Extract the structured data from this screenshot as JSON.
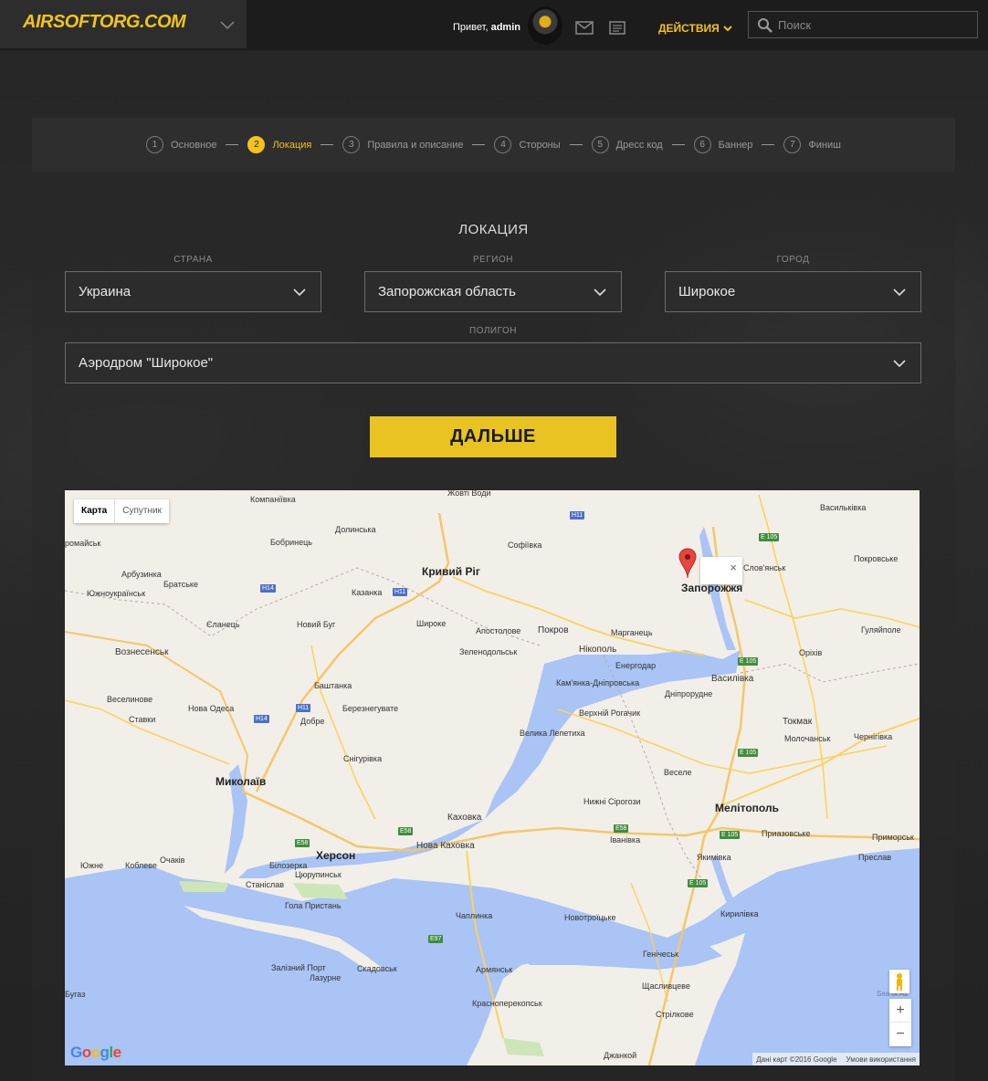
{
  "header": {
    "logo_text": "AIRSOFTORG.COM",
    "greeting_prefix": "Привет,",
    "username": "admin",
    "actions_label": "ДЕЙСТВИЯ",
    "search_placeholder": "Поиск",
    "accent_color": "#f2c31a",
    "icons": [
      "chevron-down-icon",
      "mail-icon",
      "news-icon",
      "search-icon"
    ]
  },
  "steps": [
    {
      "num": "1",
      "label": "Основное",
      "active": false
    },
    {
      "num": "2",
      "label": "Локация",
      "active": true
    },
    {
      "num": "3",
      "label": "Правила и описание",
      "active": false
    },
    {
      "num": "4",
      "label": "Стороны",
      "active": false
    },
    {
      "num": "5",
      "label": "Дресс код",
      "active": false
    },
    {
      "num": "6",
      "label": "Баннер",
      "active": false
    },
    {
      "num": "7",
      "label": "Финиш",
      "active": false
    }
  ],
  "form": {
    "title": "ЛОКАЦИЯ",
    "country": {
      "label": "СТРАНА",
      "value": "Украина"
    },
    "region": {
      "label": "РЕГИОН",
      "value": "Запорожская область"
    },
    "city": {
      "label": "ГОРОД",
      "value": "Широкое"
    },
    "polygon": {
      "label": "ПОЛИГОН",
      "value": "Аэродром \"Широкое\""
    },
    "next_button": "ДАЛЬШЕ"
  },
  "map": {
    "type_buttons": [
      "Карта",
      "Супутник"
    ],
    "infowindow_close": "×",
    "zoom_in": "+",
    "zoom_out": "−",
    "attribution": "Дані карт ©2016 Google",
    "terms": "Умови використання",
    "google": "Google",
    "sea_label": "Sea of Az",
    "cities": {
      "zhovti_vody": "Жовті Води",
      "kompaniivka": "Компаніївка",
      "dolynska": "Долинська",
      "bobrynets": "Бобринець",
      "sofiivka": "Софіївка",
      "kryvyi_rih": "Кривий Ріг",
      "kazanka": "Казанка",
      "shyroke": "Широке",
      "novyi_buh": "Новий Буг",
      "apostolove": "Апостолове",
      "pokrov": "Покров",
      "marhanets": "Марганець",
      "zelenodolsk": "Зеленодольськ",
      "nikopol": "Нікополь",
      "enerhodar": "Енергодар",
      "kamianka": "Кам'янка-Дніпровська",
      "dniprorudne": "Дніпрорудне",
      "vasylivka": "Василівка",
      "zaporizhzhia": "Запорожжя",
      "vasylkivka": "Васильківка",
      "slovianka": "Слов'янськ",
      "pokrovske": "Покровське",
      "huliaipole": "Гуляйполе",
      "orikhiv": "Оріхів",
      "tokmak": "Токмак",
      "molochansk": "Молочанськ",
      "chernihivka": "Чернігівка",
      "voznesensk": "Вознесенськ",
      "yuzhnoukrainsk": "Южноукраїнськ",
      "arbuzynka": "Арбузинка",
      "bratske": "Братське",
      "elanets": "Єланець",
      "bashtanka": "Баштанка",
      "veselynove": "Веселинове",
      "nova_odesa": "Нова Одеса",
      "bereznehuvate": "Березнегувате",
      "stavky": "Ставки",
      "dobre": "Добре",
      "snihurivka": "Снігурівка",
      "velyka_lepetykha": "Велика Лепетиха",
      "verkhnii_rohachyk": "Верхній Рогачик",
      "vesele": "Веселе",
      "mykolaiv": "Миколаїв",
      "melitopol": "Мелітополь",
      "nyzhni_sirohozy": "Нижні Сірогози",
      "kakhovka": "Каховка",
      "nova_kakhovka": "Нова Каховка",
      "ivanivka": "Іванівка",
      "pryazovske": "Приазовське",
      "prymorsk": "Приморськ",
      "yakymivka": "Якимівка",
      "preslav": "Преслав",
      "kherson": "Херсон",
      "tsiurupynsk": "Цюрупинськ",
      "biloziarka": "Білозерка",
      "ochakiv": "Очаків",
      "koblevo": "Коблеве",
      "yuzhne": "Южне",
      "stanislav": "Станіслав",
      "hola_prystan": "Гола Пристань",
      "chaplynka": "Чаплинка",
      "novotroitske": "Новотроїцьке",
      "kyrylivka": "Кирилівка",
      "henichesk": "Генічеськ",
      "skadovsk": "Скадовськ",
      "zaliznyi_port": "Залізний Порт",
      "lazurne": "Лазурне",
      "armiansk": "Армянськ",
      "shchaslyvtseve": "Щасливцеве",
      "strilkove": "Стрілкове",
      "krasnoperekopsk": "Красноперекопськ",
      "dzhankoi": "Джанкой",
      "bugaz": "Бугаз",
      "romaisk": "ромайськ"
    },
    "roads": {
      "h11": "H11",
      "h14": "H14",
      "e105": "E 105",
      "e58": "E58",
      "e97": "E97"
    }
  }
}
